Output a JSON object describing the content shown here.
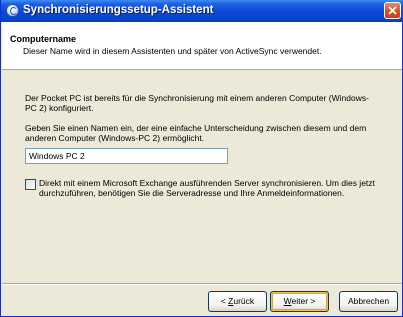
{
  "window": {
    "title": "Synchronisierungssetup-Assistent"
  },
  "header": {
    "title": "Computername",
    "subtitle": "Dieser Name wird in diesem Assistenten und später von ActiveSync verwendet."
  },
  "body": {
    "paragraph1": "Der Pocket PC ist bereits für die Synchronisierung mit einem anderen Computer (Windows-PC 2) konfiguriert.",
    "paragraph2": "Geben Sie einen Namen ein, der eine einfache Unterscheidung zwischen diesem und dem anderen Computer (Windows-PC 2) ermöglicht.",
    "name_input_value": "Windows PC 2",
    "exchange_checkbox_label": "Direkt mit einem Microsoft Exchange ausführenden Server synchronisieren. Um dies jetzt durchzuführen, benötigen Sie die Serveradresse und Ihre Anmeldeinformationen.",
    "exchange_checkbox_checked": false
  },
  "buttons": {
    "back_prefix": "< ",
    "back_mnemonic": "Z",
    "back_rest": "urück",
    "next_mnemonic": "W",
    "next_rest": "eiter >",
    "cancel": "Abbrechen"
  }
}
